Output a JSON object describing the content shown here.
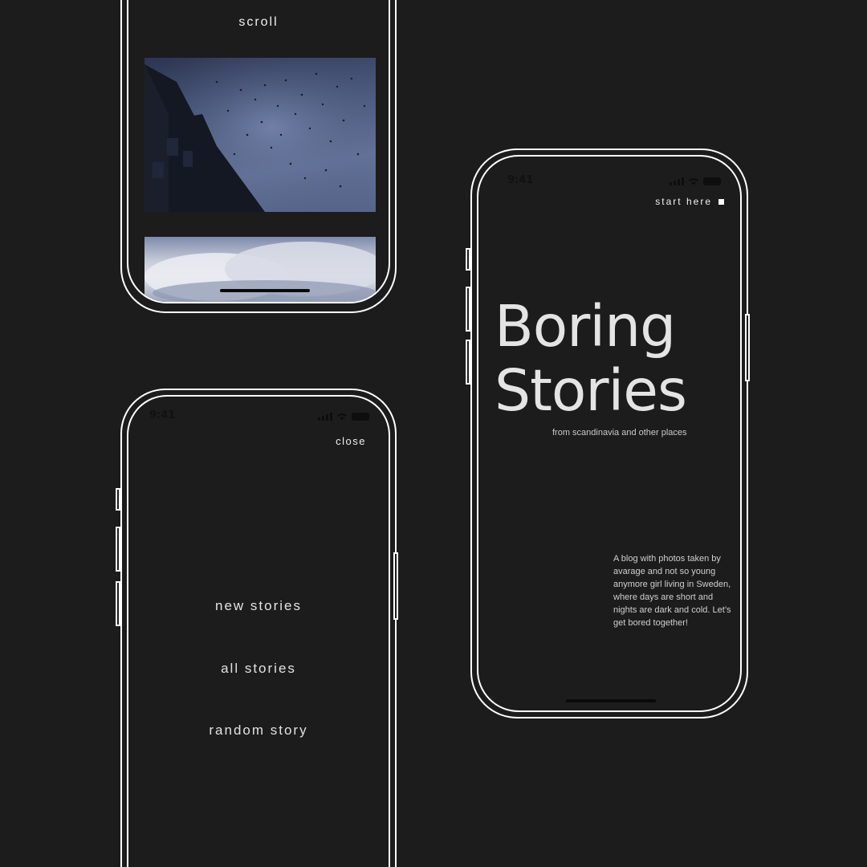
{
  "scroll_screen": {
    "label": "scroll",
    "photos": [
      {
        "name": "sky-with-birds-over-building"
      },
      {
        "name": "white-clouds"
      }
    ]
  },
  "menu_screen": {
    "status_time": "9:41",
    "close_label": "close",
    "items": [
      {
        "label": "new stories"
      },
      {
        "label": "all stories"
      },
      {
        "label": "random story"
      }
    ]
  },
  "landing_screen": {
    "status_time": "9:41",
    "start_label": "start here",
    "title_line1": "Boring",
    "title_line2": "Stories",
    "subtitle": "from scandinavia and other places",
    "blurb": "A blog with photos taken by avarage and not so young anymore girl living in Sweden, where days are short and nights are dark and cold. Let’s get bored together!"
  },
  "colors": {
    "background": "#1c1c1c",
    "frame": "#ffffff",
    "text": "#e4e4e4"
  }
}
